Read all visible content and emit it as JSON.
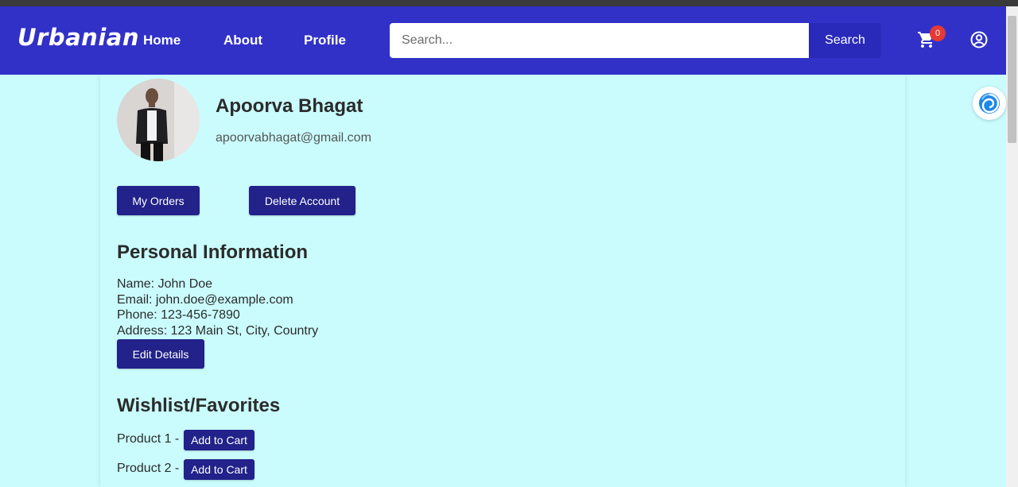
{
  "header": {
    "brand": "Urbanian",
    "nav": [
      {
        "label": "Home"
      },
      {
        "label": "About"
      },
      {
        "label": "Profile"
      }
    ],
    "search": {
      "placeholder": "Search...",
      "button_label": "Search"
    },
    "cart_count": "0",
    "colors": {
      "navbar": "#3131c8",
      "search_button": "#2a2aba",
      "badge": "#e53935"
    }
  },
  "profile": {
    "name": "Apoorva Bhagat",
    "email": "apoorvabhagat@gmail.com",
    "buttons": {
      "orders": "My Orders",
      "delete": "Delete Account"
    }
  },
  "personal_info": {
    "title": "Personal Information",
    "lines": [
      "Name: John Doe",
      "Email: john.doe@example.com",
      "Phone: 123-456-7890",
      "Address: 123 Main St, City, Country"
    ],
    "edit_label": "Edit Details"
  },
  "wishlist": {
    "title": "Wishlist/Favorites",
    "items": [
      {
        "label": "Product 1 -",
        "button": "Add to Cart"
      },
      {
        "label": "Product 2 -",
        "button": "Add to Cart"
      }
    ]
  },
  "theme": {
    "page_bg": "#cafcfd",
    "button_bg": "#22228a"
  },
  "icons": {
    "cart": "cart-icon",
    "account": "account-circle-icon",
    "widget": "spiral-icon"
  }
}
